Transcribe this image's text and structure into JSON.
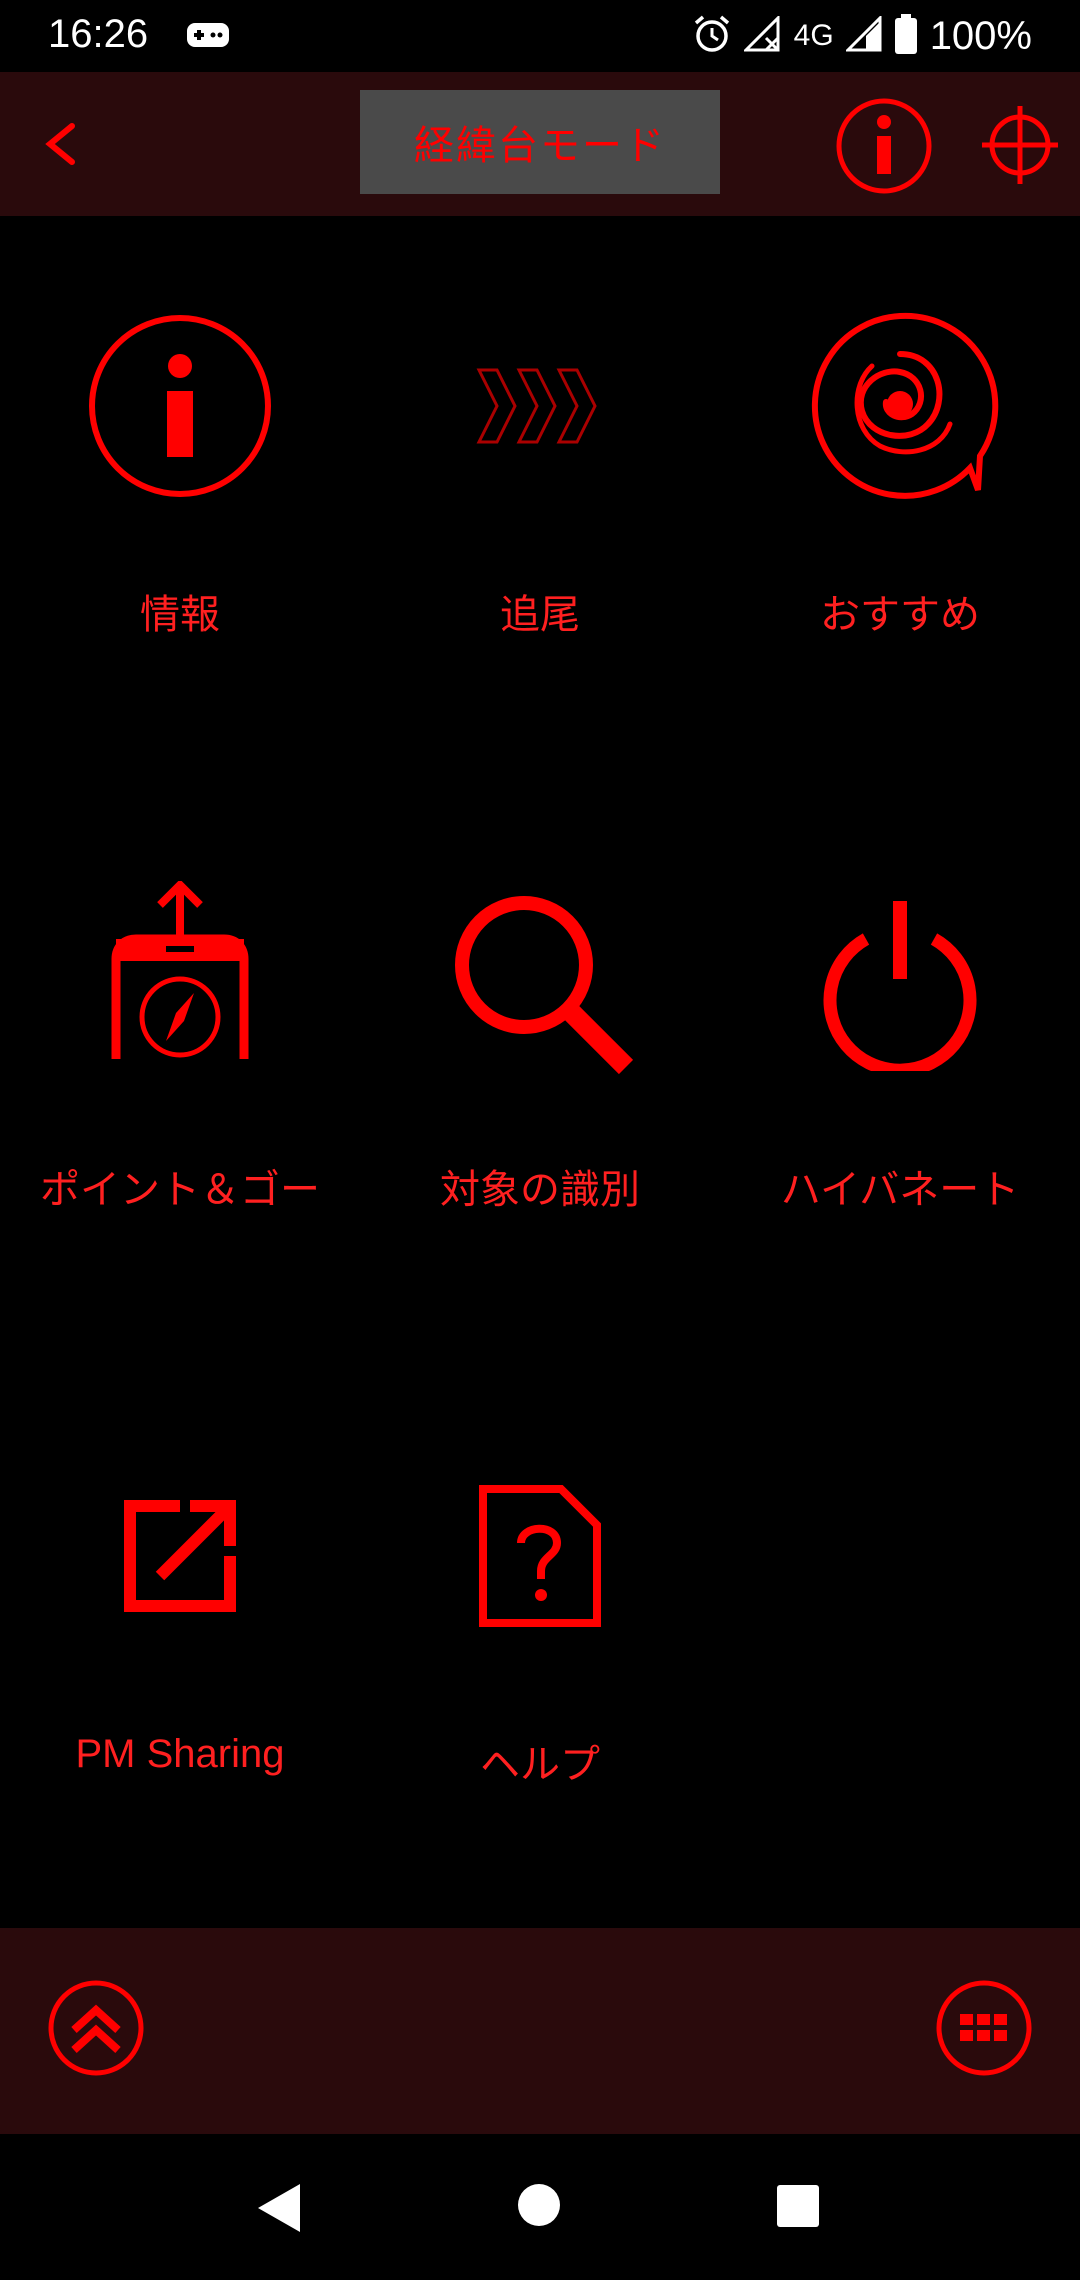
{
  "status_bar": {
    "time": "16:26",
    "network": "4G",
    "battery": "100%",
    "icons": [
      "gamepad-icon",
      "alarm-icon",
      "signal-off-icon",
      "signal-icon",
      "battery-icon"
    ]
  },
  "header": {
    "mode_label": "経緯台モード",
    "icons": [
      "back-chevron-icon",
      "info-icon",
      "crosshair-icon"
    ]
  },
  "tiles": [
    {
      "label": "情報",
      "icon": "info-icon"
    },
    {
      "label": "追尾",
      "icon": "tracking-chevrons-icon"
    },
    {
      "label": "おすすめ",
      "icon": "galaxy-icon"
    },
    {
      "label": "ポイント＆ゴー",
      "icon": "point-and-go-icon"
    },
    {
      "label": "対象の識別",
      "icon": "search-icon"
    },
    {
      "label": "ハイバネート",
      "icon": "power-icon"
    },
    {
      "label": "PM Sharing",
      "icon": "share-icon"
    },
    {
      "label": "ヘルプ",
      "icon": "help-document-icon"
    }
  ],
  "bottom_bar": {
    "icons": [
      "double-chevron-up-icon",
      "apps-grid-icon"
    ]
  },
  "nav_bar": {
    "icons": [
      "nav-back-icon",
      "nav-home-icon",
      "nav-recent-icon"
    ]
  },
  "colors": {
    "accent": "#ff0000",
    "bar_background": "#2a0a0c",
    "mode_button_background": "#4a4a4a",
    "background": "#000000"
  }
}
